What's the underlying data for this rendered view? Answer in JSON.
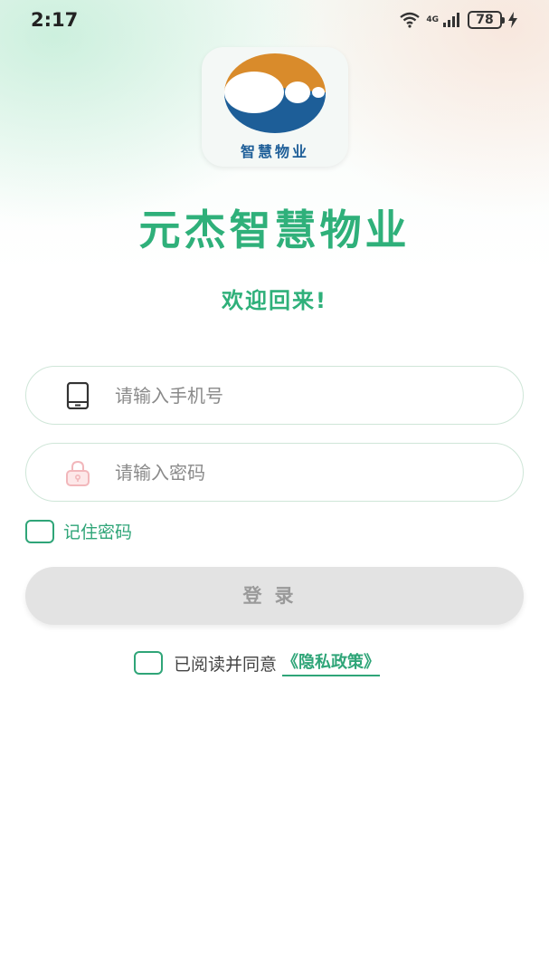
{
  "status_bar": {
    "time": "2:17",
    "network": "4G",
    "battery": "78",
    "icons": [
      "wifi-icon",
      "signal-icon",
      "battery-icon",
      "charging-icon"
    ]
  },
  "logo": {
    "text": "智慧物业"
  },
  "title": "元杰智慧物业",
  "welcome": "欢迎回来!",
  "phone_field": {
    "placeholder": "请输入手机号",
    "value": "",
    "icon": "phone-icon"
  },
  "password_field": {
    "placeholder": "请输入密码",
    "value": "",
    "icon": "lock-icon"
  },
  "remember": {
    "label": "记住密码",
    "checked": false
  },
  "login_button": "登录",
  "agreement": {
    "label": "已阅读并同意",
    "link": "《隐私政策》",
    "checked": false
  },
  "colors": {
    "accent": "#2fb07a",
    "button_disabled": "#e3e3e3",
    "logo_blue": "#1d5e98",
    "logo_orange": "#d98b2b"
  }
}
